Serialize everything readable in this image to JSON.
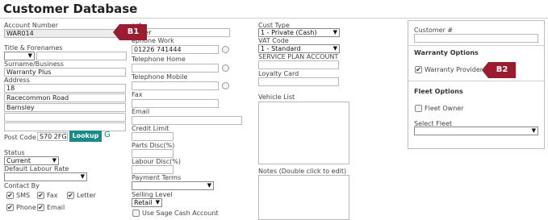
{
  "page_title": "Customer Database",
  "account_number": {
    "label": "Account Number",
    "value": "WAR014"
  },
  "title_forenames": {
    "label": "Title & Forenames",
    "value": ""
  },
  "surname": {
    "label": "Surname/Business",
    "value": "Warranty Plus"
  },
  "address": {
    "label": "Address",
    "lines": [
      "18",
      "Racecommon Road",
      "Barnsley",
      "",
      ""
    ]
  },
  "postcode": {
    "label": "Post Code",
    "value": "S70 2FG",
    "lookup_label": "Lookup",
    "refresh_glyph": "G"
  },
  "status": {
    "label": "Status",
    "value": "Current"
  },
  "labour_rate": {
    "label": "Default Labour Rate",
    "value": ""
  },
  "contact_by": {
    "label": "Contact By",
    "options": [
      {
        "label": "SMS",
        "checked": true
      },
      {
        "label": "Fax",
        "checked": true
      },
      {
        "label": "Letter",
        "checked": true
      },
      {
        "label": "Phone",
        "checked": true
      },
      {
        "label": "Email",
        "checked": true
      }
    ]
  },
  "contact": {
    "label_partial": "act",
    "value_partial": "urner"
  },
  "telephone_work": {
    "label_partial": "ephone Work",
    "value": "01226 741444"
  },
  "telephone_home": {
    "label": "Telephone Home",
    "value": ""
  },
  "telephone_mobile": {
    "label": "Telephone Mobile",
    "value": ""
  },
  "fax": {
    "label": "Fax",
    "value": ""
  },
  "email": {
    "label": "Email",
    "value": ""
  },
  "credit_limit": {
    "label": "Credit Limit",
    "value": ""
  },
  "parts_disc": {
    "label": "Parts Disc(%)",
    "value": ""
  },
  "labour_disc": {
    "label": "Labour Disc(%)",
    "value": ""
  },
  "payment_terms": {
    "label": "Payment Terms",
    "value": ""
  },
  "selling_level": {
    "label": "Selling Level",
    "value": "Retail"
  },
  "sage_cash": {
    "label": "Use Sage Cash Account",
    "checked": false
  },
  "cust_type": {
    "label": "Cust Type",
    "value": "1 - Private (Cash)"
  },
  "vat_code": {
    "label": "VAT Code",
    "value": "1 - Standard"
  },
  "service_plan": {
    "label": "SERVICE PLAN ACCOUNT",
    "value": ""
  },
  "loyalty_card": {
    "label": "Loyalty Card",
    "value": ""
  },
  "vehicle_list": {
    "label": "Vehicle List"
  },
  "notes": {
    "label": "Notes (Double click to edit)"
  },
  "customer_number": {
    "label": "Customer #",
    "value": ""
  },
  "warranty_options": {
    "title": "Warranty Options",
    "warranty_provider": {
      "label": "Warranty Provider",
      "checked": true
    }
  },
  "fleet_options": {
    "title": "Fleet Options",
    "fleet_owner": {
      "label": "Fleet Owner",
      "checked": false
    },
    "select_fleet": {
      "label": "Select Fleet",
      "value": ""
    }
  },
  "badges": {
    "b1": "B1",
    "b2": "B2"
  },
  "colors": {
    "badge": "#9b1c31",
    "lookup_button": "#1a8a86"
  }
}
